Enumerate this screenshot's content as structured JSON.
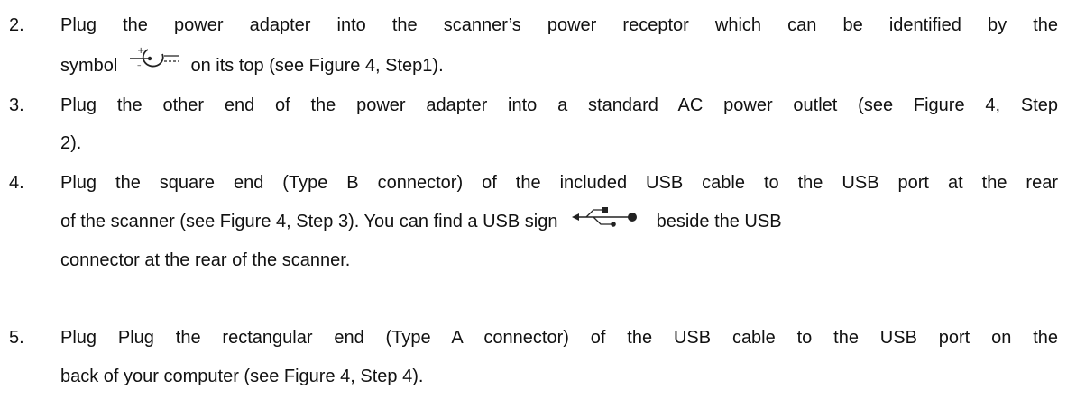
{
  "steps": [
    {
      "number": "2.",
      "line1": "Plug the power adapter into the scanner’s power receptor which can be identified by the",
      "line2_before": "symbol",
      "line2_after": "on its top (see Figure 4, Step1).",
      "icon": "power-receptor-icon"
    },
    {
      "number": "3.",
      "line1": "Plug the other end of the power adapter into a standard AC power outlet (see Figure 4, Step",
      "line2": "2)."
    },
    {
      "number": "4.",
      "line1": "Plug the square end (Type B connector) of the included USB cable to the USB port at the rear",
      "line2_before": "of the scanner (see Figure 4, Step 3).  You can find a USB sign",
      "line2_after": "beside the USB",
      "line3": "connector at the rear of the scanner.",
      "icon": "usb-icon"
    },
    {
      "number": "5.",
      "line1": "Plug Plug the rectangular end (Type A connector) of the USB cable to the USB port on the",
      "line2": "back of your computer (see Figure 4, Step 4)."
    }
  ]
}
